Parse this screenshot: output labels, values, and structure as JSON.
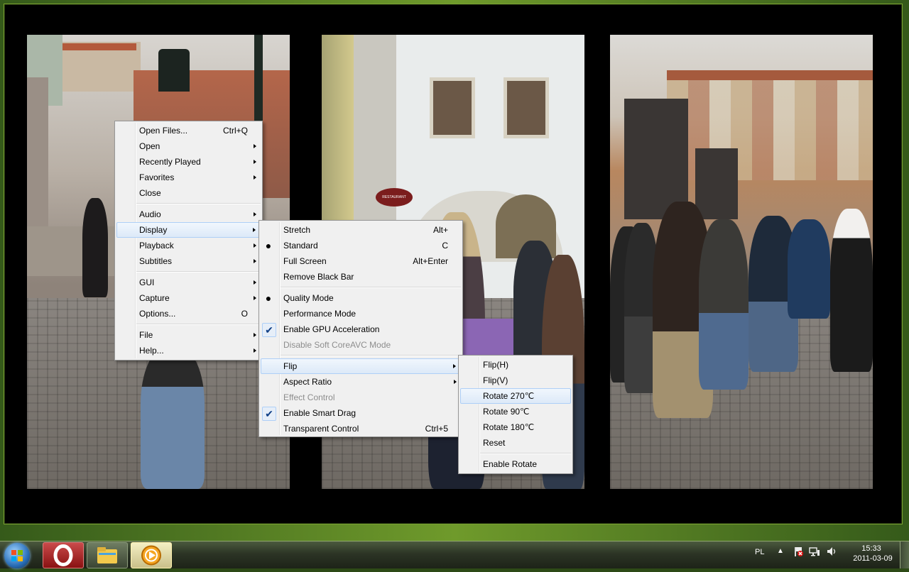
{
  "main_menu": {
    "items": [
      {
        "label": "Open Files...",
        "shortcut": "Ctrl+Q"
      },
      {
        "label": "Open",
        "submenu": true
      },
      {
        "label": "Recently Played",
        "submenu": true
      },
      {
        "label": "Favorites",
        "submenu": true
      },
      {
        "label": "Close"
      },
      {
        "label": "Audio",
        "submenu": true
      },
      {
        "label": "Display",
        "submenu": true
      },
      {
        "label": "Playback",
        "submenu": true
      },
      {
        "label": "Subtitles",
        "submenu": true
      },
      {
        "label": "GUI",
        "submenu": true
      },
      {
        "label": "Capture",
        "submenu": true
      },
      {
        "label": "Options...",
        "shortcut": "O"
      },
      {
        "label": "File",
        "submenu": true
      },
      {
        "label": "Help...",
        "submenu": true
      }
    ]
  },
  "display_menu": {
    "items": [
      {
        "label": "Stretch",
        "shortcut": "Alt+"
      },
      {
        "label": "Standard",
        "shortcut": "C",
        "state": "radio"
      },
      {
        "label": "Full Screen",
        "shortcut": "Alt+Enter"
      },
      {
        "label": "Remove Black Bar"
      },
      {
        "label": "Quality Mode",
        "state": "radio"
      },
      {
        "label": "Performance Mode"
      },
      {
        "label": "Enable GPU Acceleration",
        "state": "checked"
      },
      {
        "label": "Disable Soft CoreAVC Mode",
        "disabled": true
      },
      {
        "label": "Flip",
        "submenu": true
      },
      {
        "label": "Aspect Ratio",
        "submenu": true
      },
      {
        "label": "Effect Control",
        "disabled": true
      },
      {
        "label": "Enable Smart Drag",
        "state": "checked"
      },
      {
        "label": "Transparent Control",
        "shortcut": "Ctrl+5"
      }
    ]
  },
  "flip_menu": {
    "items": [
      {
        "label": "Flip(H)"
      },
      {
        "label": "Flip(V)"
      },
      {
        "label": "Rotate 270℃"
      },
      {
        "label": "Rotate 90℃"
      },
      {
        "label": "Rotate 180℃"
      },
      {
        "label": "Reset"
      },
      {
        "label": "Enable Rotate"
      }
    ]
  },
  "scene": {
    "sign_text": "RESTAURANT"
  },
  "taskbar": {
    "language": "PL",
    "time": "15:33",
    "date": "2011-03-09",
    "apps": [
      "Opera",
      "Windows Explorer",
      "KMPlayer"
    ]
  },
  "colors": {
    "menu_bg": "#f0f0f0",
    "highlight_border": "#aecff7",
    "taskbar": "#2c3425"
  }
}
